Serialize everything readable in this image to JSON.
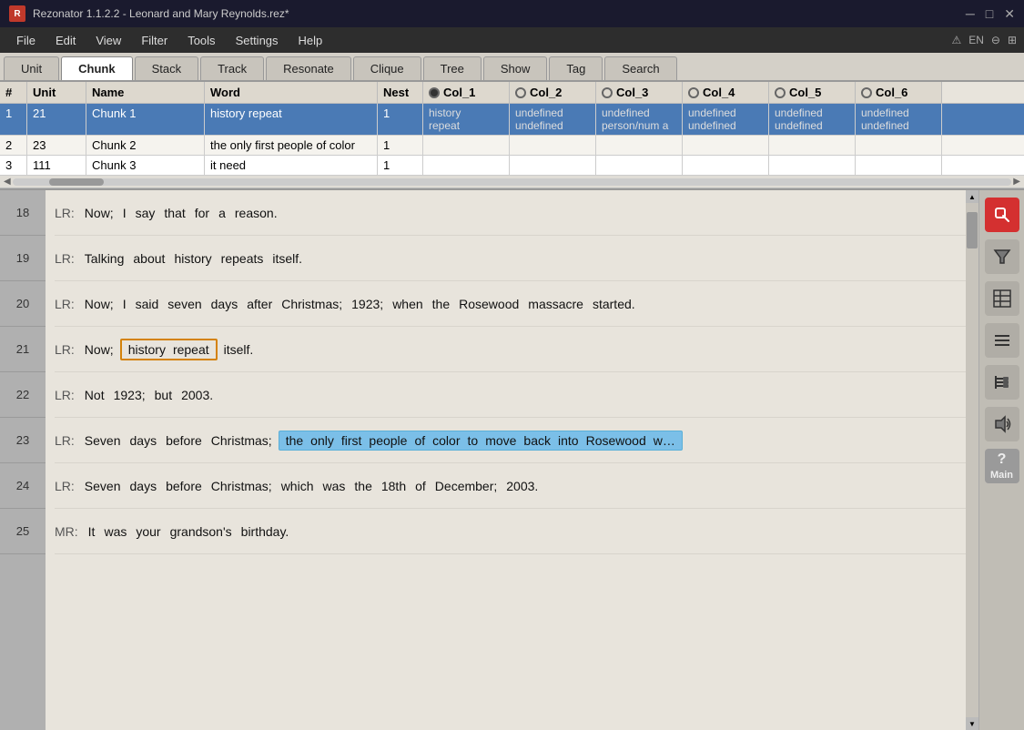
{
  "titleBar": {
    "appIcon": "R",
    "title": "Rezonator 1.1.2.2 - Leonard and Mary Reynolds.rez*",
    "winMin": "─",
    "winMax": "□",
    "winClose": "✕"
  },
  "menuBar": {
    "items": [
      "File",
      "Edit",
      "View",
      "Filter",
      "Tools",
      "Settings",
      "Help"
    ],
    "rightIcons": [
      "⚠",
      "EN",
      "⊖",
      "⊞"
    ]
  },
  "tabs": [
    {
      "id": "unit",
      "label": "Unit"
    },
    {
      "id": "chunk",
      "label": "Chunk",
      "active": true
    },
    {
      "id": "stack",
      "label": "Stack"
    },
    {
      "id": "track",
      "label": "Track"
    },
    {
      "id": "resonate",
      "label": "Resonate"
    },
    {
      "id": "clique",
      "label": "Clique"
    },
    {
      "id": "tree",
      "label": "Tree"
    },
    {
      "id": "show",
      "label": "Show"
    },
    {
      "id": "tag",
      "label": "Tag"
    },
    {
      "id": "search",
      "label": "Search"
    }
  ],
  "tableHeader": {
    "hash": "#",
    "unit": "Unit",
    "name": "Name",
    "word": "Word",
    "nest": "Nest",
    "col1": "Col_1",
    "col2": "Col_2",
    "col3": "Col_3",
    "col4": "Col_4",
    "col5": "Col_5",
    "col6": "Col_6"
  },
  "tableRows": [
    {
      "num": "1",
      "unit": "21",
      "name": "Chunk 1",
      "word": "history repeat",
      "nest": "1",
      "col1": "history\nrepeat",
      "col2": "undefined\nundefined",
      "col3": "undefined\nperson/num a",
      "col4": "undefined\nundefined",
      "col5": "undefined\nundefined",
      "col6": "undefined\nundefined",
      "selected": true
    },
    {
      "num": "2",
      "unit": "23",
      "name": "Chunk 2",
      "word": "the only first people of color",
      "nest": "1",
      "col1": "",
      "col2": "",
      "col3": "",
      "col4": "",
      "col5": "",
      "col6": "",
      "selected": false
    },
    {
      "num": "3",
      "unit": "111",
      "name": "Chunk 3",
      "word": "it need",
      "nest": "1",
      "col1": "",
      "col2": "",
      "col3": "",
      "col4": "",
      "col5": "",
      "col6": "",
      "selected": false
    }
  ],
  "textLines": [
    {
      "num": "18",
      "speaker": "LR:",
      "words": [
        "Now;",
        "I",
        "say",
        "that",
        "for",
        "a",
        "reason."
      ],
      "highlight": null
    },
    {
      "num": "19",
      "speaker": "LR:",
      "words": [
        "Talking",
        "about",
        "history",
        "repeats",
        "itself."
      ],
      "highlight": null
    },
    {
      "num": "20",
      "speaker": "LR:",
      "words": [
        "Now;",
        "I",
        "said",
        "seven",
        "days",
        "after",
        "Christmas;",
        "1923;",
        "when",
        "the",
        "Rosewood",
        "massacre",
        "started."
      ],
      "highlight": null
    },
    {
      "num": "21",
      "speaker": "LR:",
      "words": [
        "Now;"
      ],
      "highlightChunk": [
        "history",
        "repeat"
      ],
      "afterChunk": [
        "itself."
      ],
      "highlight": "chunk"
    },
    {
      "num": "22",
      "speaker": "LR:",
      "words": [
        "Not",
        "1923;",
        "but",
        "2003."
      ],
      "highlight": null
    },
    {
      "num": "23",
      "speaker": "LR:",
      "wordsBeforeHighlight": [
        "Seven",
        "days",
        "before",
        "Christmas;"
      ],
      "highlightPhrase": [
        "the",
        "only",
        "first",
        "people",
        "of",
        "color",
        "to",
        "move",
        "back",
        "into",
        "Rosewood",
        "w"
      ],
      "highlight": "phrase"
    },
    {
      "num": "24",
      "speaker": "LR:",
      "words": [
        "Seven",
        "days",
        "before",
        "Christmas;",
        "which",
        "was",
        "the",
        "18th",
        "of",
        "December;",
        "2003."
      ],
      "highlight": null
    },
    {
      "num": "25",
      "speaker": "MR:",
      "words": [
        "It",
        "was",
        "your",
        "grandson's",
        "birthday."
      ],
      "highlight": null
    }
  ],
  "rightToolbar": {
    "buttons": [
      {
        "id": "search-btn",
        "icon": "S",
        "color": "red"
      },
      {
        "id": "filter-btn",
        "icon": "⏶",
        "color": "gray"
      },
      {
        "id": "table-btn",
        "icon": "≡",
        "color": "gray"
      },
      {
        "id": "list-btn",
        "icon": "☰",
        "color": "gray"
      },
      {
        "id": "tree-btn",
        "icon": "⊢",
        "color": "gray"
      },
      {
        "id": "audio-btn",
        "icon": "♪",
        "color": "gray"
      },
      {
        "id": "main-btn",
        "icon": "?",
        "label": "Main",
        "color": "main"
      }
    ]
  }
}
